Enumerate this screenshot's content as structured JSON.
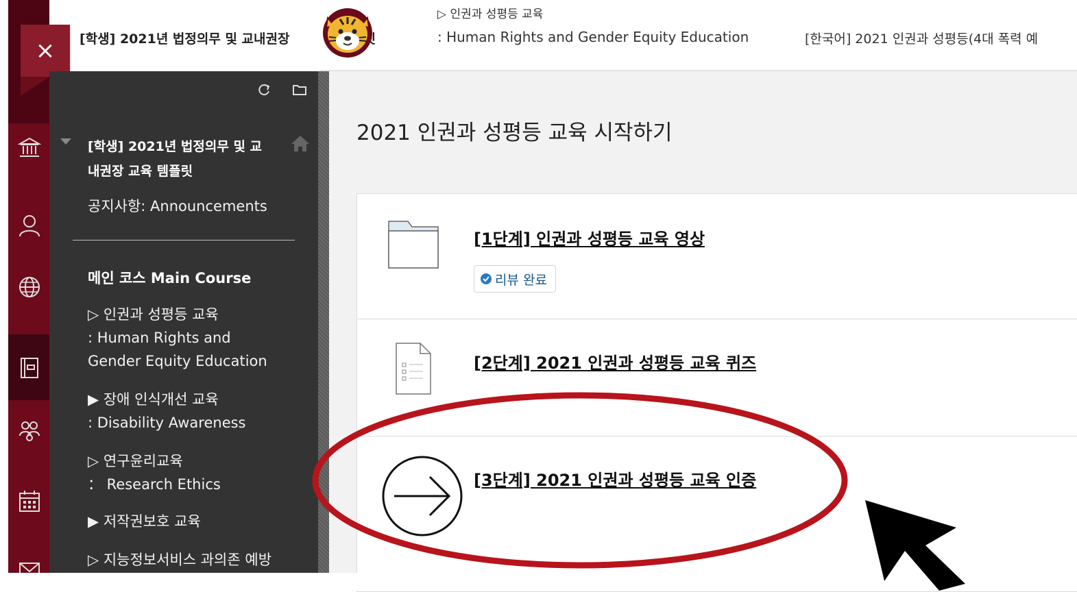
{
  "topbar": {
    "course": "[학생] 2021년 법정의무 및 교내권장 교육 템플릿",
    "course_visible_left": "[학생] 2021년 법정의무 및 교내권장 ",
    "course_visible_right": "플릿",
    "section_line1": "▷ 인권과 성평등 교육",
    "section_line2": ": Human Rights and Gender Equity Education",
    "item": "[한국어] 2021 인권과 성평등(4대 폭력 예"
  },
  "close_label": "×",
  "menu": {
    "course_title_line1": "[학생] 2021년 법정의무 및 교",
    "course_title_line2": "내권장 교육 템플릿",
    "announcements": "공지사항: Announcements",
    "main_course": "메인 코스 Main Course",
    "items": [
      {
        "line1": "▷ 인권과 성평등 교육",
        "line2": ": Human Rights and",
        "line3": "Gender Equity Education"
      },
      {
        "line1": "▶ 장애 인식개선 교육",
        "line2": ": Disability Awareness"
      },
      {
        "line1": "▷ 연구윤리교육",
        "line2": "： Research Ethics"
      },
      {
        "line1": "▶ 저작권보호 교육"
      },
      {
        "line1": "▷ 지능정보서비스 과의존 예방"
      }
    ]
  },
  "content": {
    "title": "2021 인권과 성평등 교육 시작하기",
    "cards": [
      {
        "title": "[1단계] 인권과 성평등 교육 영상",
        "icon": "folder-icon",
        "badge": "리뷰 완료"
      },
      {
        "title": "[2단계] 2021 인권과 성평등 교육 퀴즈",
        "icon": "test-document-icon"
      },
      {
        "title": "[3단계] 2021 인권과 성평등 교육 인증",
        "icon": "arrow-circle-icon"
      }
    ]
  },
  "colors": {
    "rail": "#6d0a1b",
    "menu": "#333333",
    "content_bg": "#f2f2f2",
    "annotation_ellipse": "#b8141c",
    "badge_text": "#1a5a8a"
  }
}
